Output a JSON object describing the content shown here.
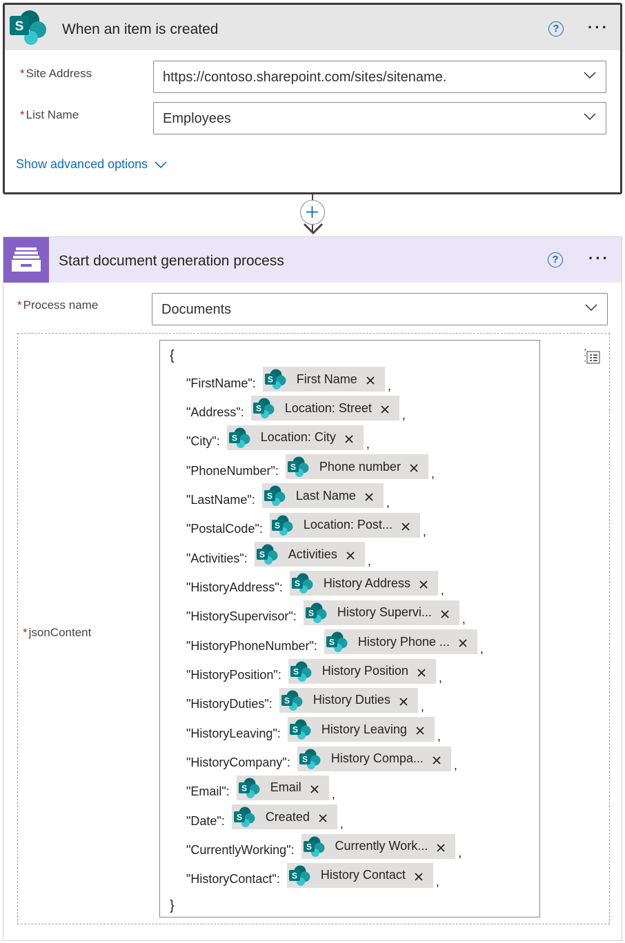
{
  "trigger": {
    "title": "When an item is created",
    "help": "?",
    "more": "···",
    "fields": [
      {
        "label": "Site Address",
        "required": "*",
        "value": "https://contoso.sharepoint.com/sites/sitename."
      },
      {
        "label": "List Name",
        "required": "*",
        "value": "Employees"
      }
    ],
    "advanced_link": "Show advanced options"
  },
  "action": {
    "title": "Start document generation process",
    "help": "?",
    "more": "···",
    "process": {
      "label": "Process name",
      "required": "*",
      "value": "Documents"
    },
    "json": {
      "label": "jsonContent",
      "required": "*",
      "open_brace": "{",
      "close_brace": "}",
      "rows": [
        {
          "key": "\"FirstName\":",
          "token": "First Name"
        },
        {
          "key": "\"Address\":",
          "token": "Location: Street"
        },
        {
          "key": "\"City\":",
          "token": "Location: City"
        },
        {
          "key": "\"PhoneNumber\":",
          "token": "Phone number"
        },
        {
          "key": "\"LastName\":",
          "token": "Last Name"
        },
        {
          "key": "\"PostalCode\":",
          "token": "Location: Post..."
        },
        {
          "key": "\"Activities\":",
          "token": "Activities"
        },
        {
          "key": "\"HistoryAddress\":",
          "token": "History Address"
        },
        {
          "key": "\"HistorySupervisor\":",
          "token": "History Supervi..."
        },
        {
          "key": "\"HistoryPhoneNumber\":",
          "token": "History Phone ..."
        },
        {
          "key": "\"HistoryPosition\":",
          "token": "History Position"
        },
        {
          "key": "\"HistoryDuties\":",
          "token": "History Duties"
        },
        {
          "key": "\"HistoryLeaving\":",
          "token": "History Leaving"
        },
        {
          "key": "\"HistoryCompany\":",
          "token": "History Compa..."
        },
        {
          "key": "\"Email\":",
          "token": "Email"
        },
        {
          "key": "\"Date\":",
          "token": "Created"
        },
        {
          "key": "\"CurrentlyWorking\":",
          "token": "Currently Work..."
        },
        {
          "key": "\"HistoryContact\":",
          "token": "History Contact"
        }
      ],
      "comma": ","
    }
  },
  "colors": {
    "sharepoint_dark": "#036c70",
    "sharepoint_mid": "#1a9ba1",
    "sharepoint_light": "#37c6d0",
    "action_accent": "#8661c5",
    "link": "#0f6cbd",
    "required": "#a4262c"
  }
}
